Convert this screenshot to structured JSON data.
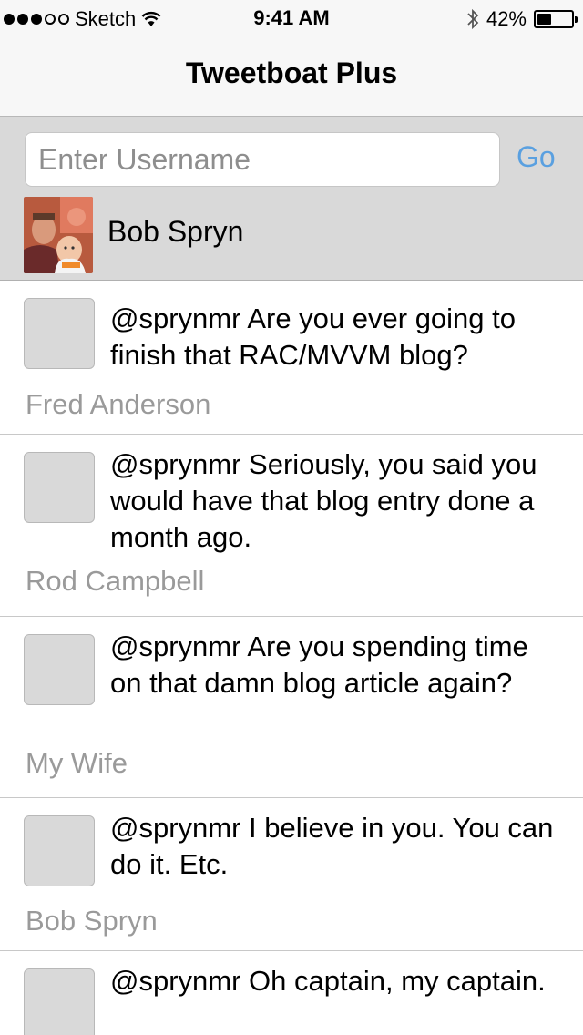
{
  "status_bar": {
    "carrier": "Sketch",
    "time": "9:41 AM",
    "battery_text": "42%",
    "battery_level": 0.42,
    "signal_dots_filled": 3,
    "signal_dots_total": 5
  },
  "nav": {
    "title": "Tweetboat Plus"
  },
  "search": {
    "placeholder": "Enter Username",
    "value": "",
    "go_label": "Go"
  },
  "user": {
    "name": "Bob Spryn"
  },
  "colors": {
    "accent": "#5aa0e0",
    "header_bg": "#d9d9d9",
    "author_gray": "#9a9a9a"
  },
  "tweets": [
    {
      "text": "@sprynmr Are you ever going to finish that RAC/MVVM blog?",
      "author": "Fred Anderson"
    },
    {
      "text": "@sprynmr Seriously, you said you would have that blog entry done a month ago.",
      "author": "Rod Campbell"
    },
    {
      "text": "@sprynmr Are you spending time on that damn blog article again?",
      "author": "My Wife"
    },
    {
      "text": "@sprynmr I believe in you. You can do it. Etc.",
      "author": "Bob Spryn"
    },
    {
      "text": "@sprynmr Oh captain, my captain.",
      "author": ""
    }
  ]
}
